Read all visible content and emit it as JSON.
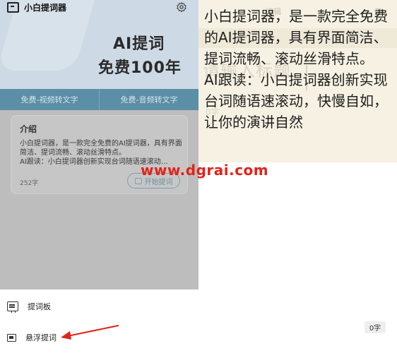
{
  "app": {
    "title": "小白提词器",
    "hero_line1": "AI提词",
    "hero_line2": "免费100年"
  },
  "tabs": [
    "免费-视频转文字",
    "免费-音频转文字"
  ],
  "card": {
    "title": "介绍",
    "text": "小白提词器，是一款完全免费的AI提词器，具有界面简洁、提词流畅、滚动丝滑特点。\nAI跟读：小白提词器创新实现台词随语速滚动…",
    "count": "252字",
    "start_button": "开始提词"
  },
  "prompter": {
    "text": "小白提词器，是一款完全免费的AI提词器，具有界面简洁、提词流畅、滚动丝滑特点。\nAI跟读：小白提词器创新实现台词随语速滚动，快慢自如，让你的演讲自然",
    "bg_edit": "编辑",
    "bg_save": "存",
    "bg_title": "请输入标题",
    "bg_count": "0字"
  },
  "watermark": "www.dgrai.com",
  "sheet": {
    "items": [
      {
        "label": "提词板",
        "icon": "prompter-board-icon"
      },
      {
        "label": "悬浮提词",
        "icon": "floating-prompter-icon"
      }
    ],
    "char_count": "0字"
  },
  "colors": {
    "tab_bar": "#5a8fa6",
    "hero": "#cdd9e4",
    "prompter_bg": "#f6f1e2",
    "watermark": "#e2231a",
    "arrow": "#e2231a"
  }
}
